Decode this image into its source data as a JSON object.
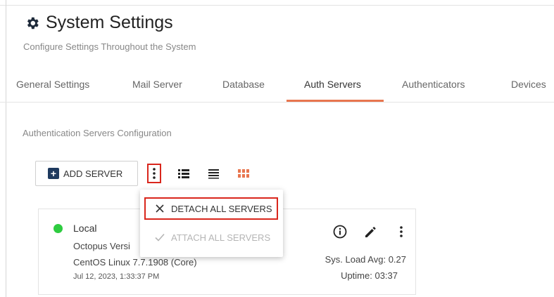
{
  "header": {
    "title": "System Settings",
    "subtitle": "Configure Settings Throughout the System"
  },
  "tabs": [
    {
      "label": "General Settings",
      "active": false
    },
    {
      "label": "Mail Server",
      "active": false
    },
    {
      "label": "Database",
      "active": false
    },
    {
      "label": "Auth Servers",
      "active": true
    },
    {
      "label": "Authenticators",
      "active": false
    },
    {
      "label": "Devices",
      "active": false
    }
  ],
  "section": {
    "title": "Authentication Servers Configuration"
  },
  "toolbar": {
    "add_server_label": "ADD SERVER"
  },
  "menu": {
    "detach_label": "DETACH ALL SERVERS",
    "attach_label": "ATTACH ALL SERVERS"
  },
  "server": {
    "name": "Local",
    "version": "Octopus Versi",
    "os": "CentOS Linux 7.7.1908 (Core)",
    "date": "Jul 12, 2023, 1:33:37 PM",
    "load": "Sys. Load Avg: 0.27",
    "uptime": "Uptime: 03:37",
    "status": "online"
  },
  "colors": {
    "accent": "#e8764f",
    "highlight": "#d9261c",
    "status_online": "#2ecc40",
    "brand_dark": "#1e3a5f"
  }
}
